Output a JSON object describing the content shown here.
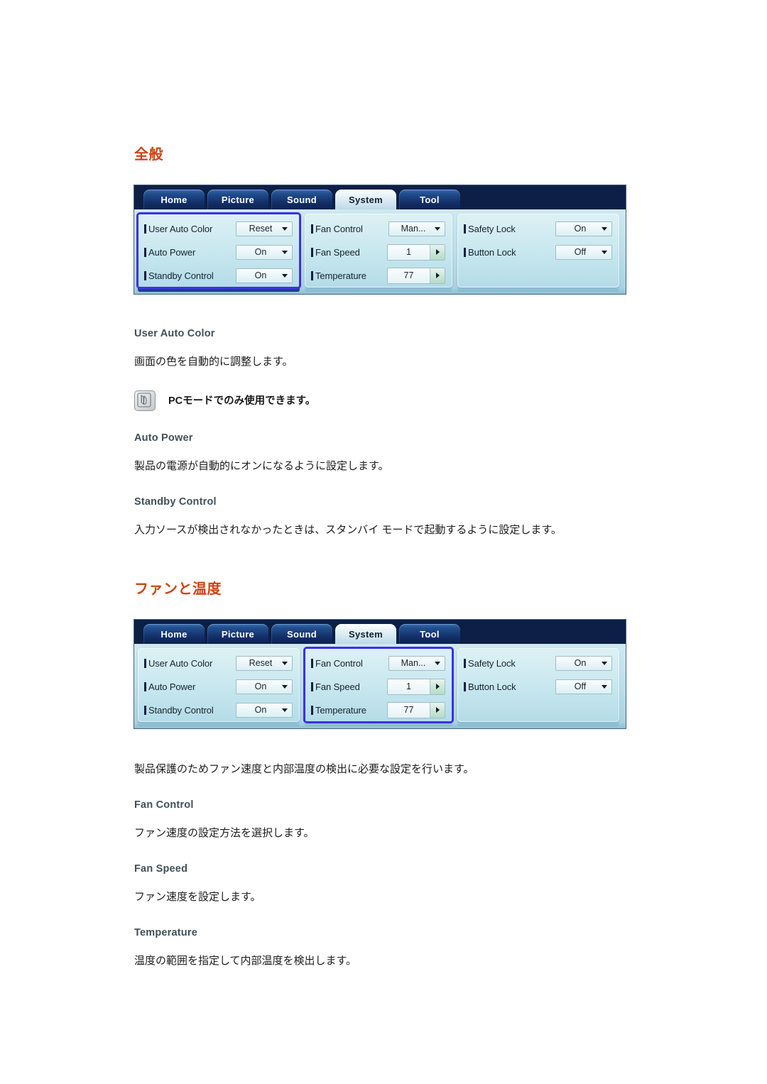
{
  "sections": [
    {
      "heading": "全般",
      "osd": {
        "tabs": [
          {
            "label": "Home",
            "active": false
          },
          {
            "label": "Picture",
            "active": false
          },
          {
            "label": "Sound",
            "active": false
          },
          {
            "label": "System",
            "active": true
          },
          {
            "label": "Tool",
            "active": false
          }
        ],
        "columns": [
          {
            "selected": true,
            "rows": [
              {
                "label": "User Auto Color",
                "value": "Reset",
                "control": "select"
              },
              {
                "label": "Auto Power",
                "value": "On",
                "control": "select"
              },
              {
                "label": "Standby Control",
                "value": "On",
                "control": "select"
              }
            ]
          },
          {
            "selected": false,
            "rows": [
              {
                "label": "Fan Control",
                "value": "Man...",
                "control": "select"
              },
              {
                "label": "Fan Speed",
                "value": "1",
                "control": "stepper"
              },
              {
                "label": "Temperature",
                "value": "77",
                "control": "stepper"
              }
            ]
          },
          {
            "selected": false,
            "rows": [
              {
                "label": "Safety Lock",
                "value": "On",
                "control": "select"
              },
              {
                "label": "Button Lock",
                "value": "Off",
                "control": "select"
              }
            ]
          }
        ]
      },
      "blocks": [
        {
          "sub": "User Auto Color",
          "text": "画面の色を自動的に調整します。"
        },
        {
          "note": "PCモードでのみ使用できます。"
        },
        {
          "sub": "Auto Power",
          "text": "製品の電源が自動的にオンになるように設定します。"
        },
        {
          "sub": "Standby Control",
          "text": "入力ソースが検出されなかったときは、スタンバイ モードで起動するように設定します。"
        }
      ]
    },
    {
      "heading": "ファンと温度",
      "osd": {
        "tabs": [
          {
            "label": "Home",
            "active": false
          },
          {
            "label": "Picture",
            "active": false
          },
          {
            "label": "Sound",
            "active": false
          },
          {
            "label": "System",
            "active": true
          },
          {
            "label": "Tool",
            "active": false
          }
        ],
        "columns": [
          {
            "selected": false,
            "rows": [
              {
                "label": "User Auto Color",
                "value": "Reset",
                "control": "select"
              },
              {
                "label": "Auto Power",
                "value": "On",
                "control": "select"
              },
              {
                "label": "Standby Control",
                "value": "On",
                "control": "select"
              }
            ]
          },
          {
            "selected": true,
            "rows": [
              {
                "label": "Fan Control",
                "value": "Man...",
                "control": "select"
              },
              {
                "label": "Fan Speed",
                "value": "1",
                "control": "stepper"
              },
              {
                "label": "Temperature",
                "value": "77",
                "control": "stepper"
              }
            ]
          },
          {
            "selected": false,
            "rows": [
              {
                "label": "Safety Lock",
                "value": "On",
                "control": "select"
              },
              {
                "label": "Button Lock",
                "value": "Off",
                "control": "select"
              }
            ]
          }
        ]
      },
      "intro": "製品保護のためファン速度と内部温度の検出に必要な設定を行います。",
      "blocks": [
        {
          "sub": "Fan Control",
          "text": "ファン速度の設定方法を選択します。"
        },
        {
          "sub": "Fan Speed",
          "text": "ファン速度を設定します。"
        },
        {
          "sub": "Temperature",
          "text": "温度の範囲を指定して内部温度を検出します。"
        }
      ]
    }
  ],
  "colors": {
    "heading": "#cc4411",
    "subheading": "#40505a",
    "body": "#1d1d1d",
    "osd_selection": "#3b30ec",
    "osd_tabbar": "#11255a"
  },
  "icons": {
    "note": "note-pencil-icon",
    "caret_down": "chevron-down-icon",
    "caret_right": "chevron-right-icon"
  }
}
